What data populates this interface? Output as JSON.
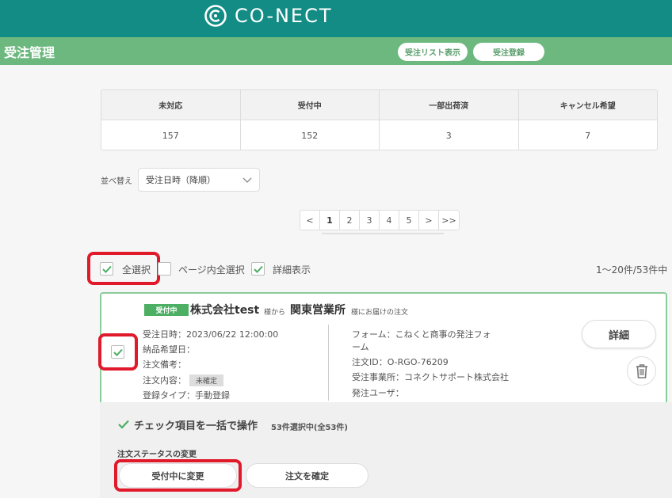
{
  "header": {
    "logo_text": "CO-NECT",
    "logo_icon": "co-nect-logo-icon",
    "bg_color": "#128c84"
  },
  "titlebar": {
    "title": "受注管理",
    "list_button": "受注リスト表示",
    "register_button": "受注登録",
    "bg_color": "#6cb87e"
  },
  "stats": {
    "headers": [
      "未対応",
      "受付中",
      "一部出荷済",
      "キャンセル希望"
    ],
    "values": [
      "157",
      "152",
      "3",
      "7"
    ]
  },
  "sort": {
    "label": "並べ替え",
    "value": "受注日時（降順）"
  },
  "pagination": {
    "prev": "<",
    "pages": [
      "1",
      "2",
      "3",
      "4",
      "5"
    ],
    "current": "1",
    "next": ">",
    "last": ">>"
  },
  "selection": {
    "select_all": "全選択",
    "page_select_all": "ページ内全選択",
    "detail_view": "詳細表示",
    "count": "1〜20件/53件中"
  },
  "order": {
    "status_badge": "受付中",
    "company": "株式会社test",
    "company_suffix": "様から",
    "office": "関東営業所",
    "office_suffix": "様にお届けの注文",
    "left_fields": [
      "受注日時：2023/06/22 12:00:00",
      "納品希望日：",
      "注文備考：",
      "注文内容：",
      "登録タイプ：手動登録"
    ],
    "content_tag": "未確定",
    "right_fields": [
      "フォーム：こねくと商事の発注フォ",
      "ーム",
      "注文ID：O-RGO-76209",
      "受注事業所：コネクトサポート株式会社",
      "発注ユーザ："
    ],
    "detail_button": "詳細",
    "trash_icon": "trash-icon"
  },
  "bulk": {
    "title": "チェック項目を一括で操作",
    "count": "53件選択中(全53件)",
    "status_label": "注文ステータスの変更",
    "btn_accept": "受付中に変更",
    "btn_confirm": "注文を確定"
  },
  "colors": {
    "accent_green": "#4caf63",
    "highlight_red": "#e01a2b"
  }
}
